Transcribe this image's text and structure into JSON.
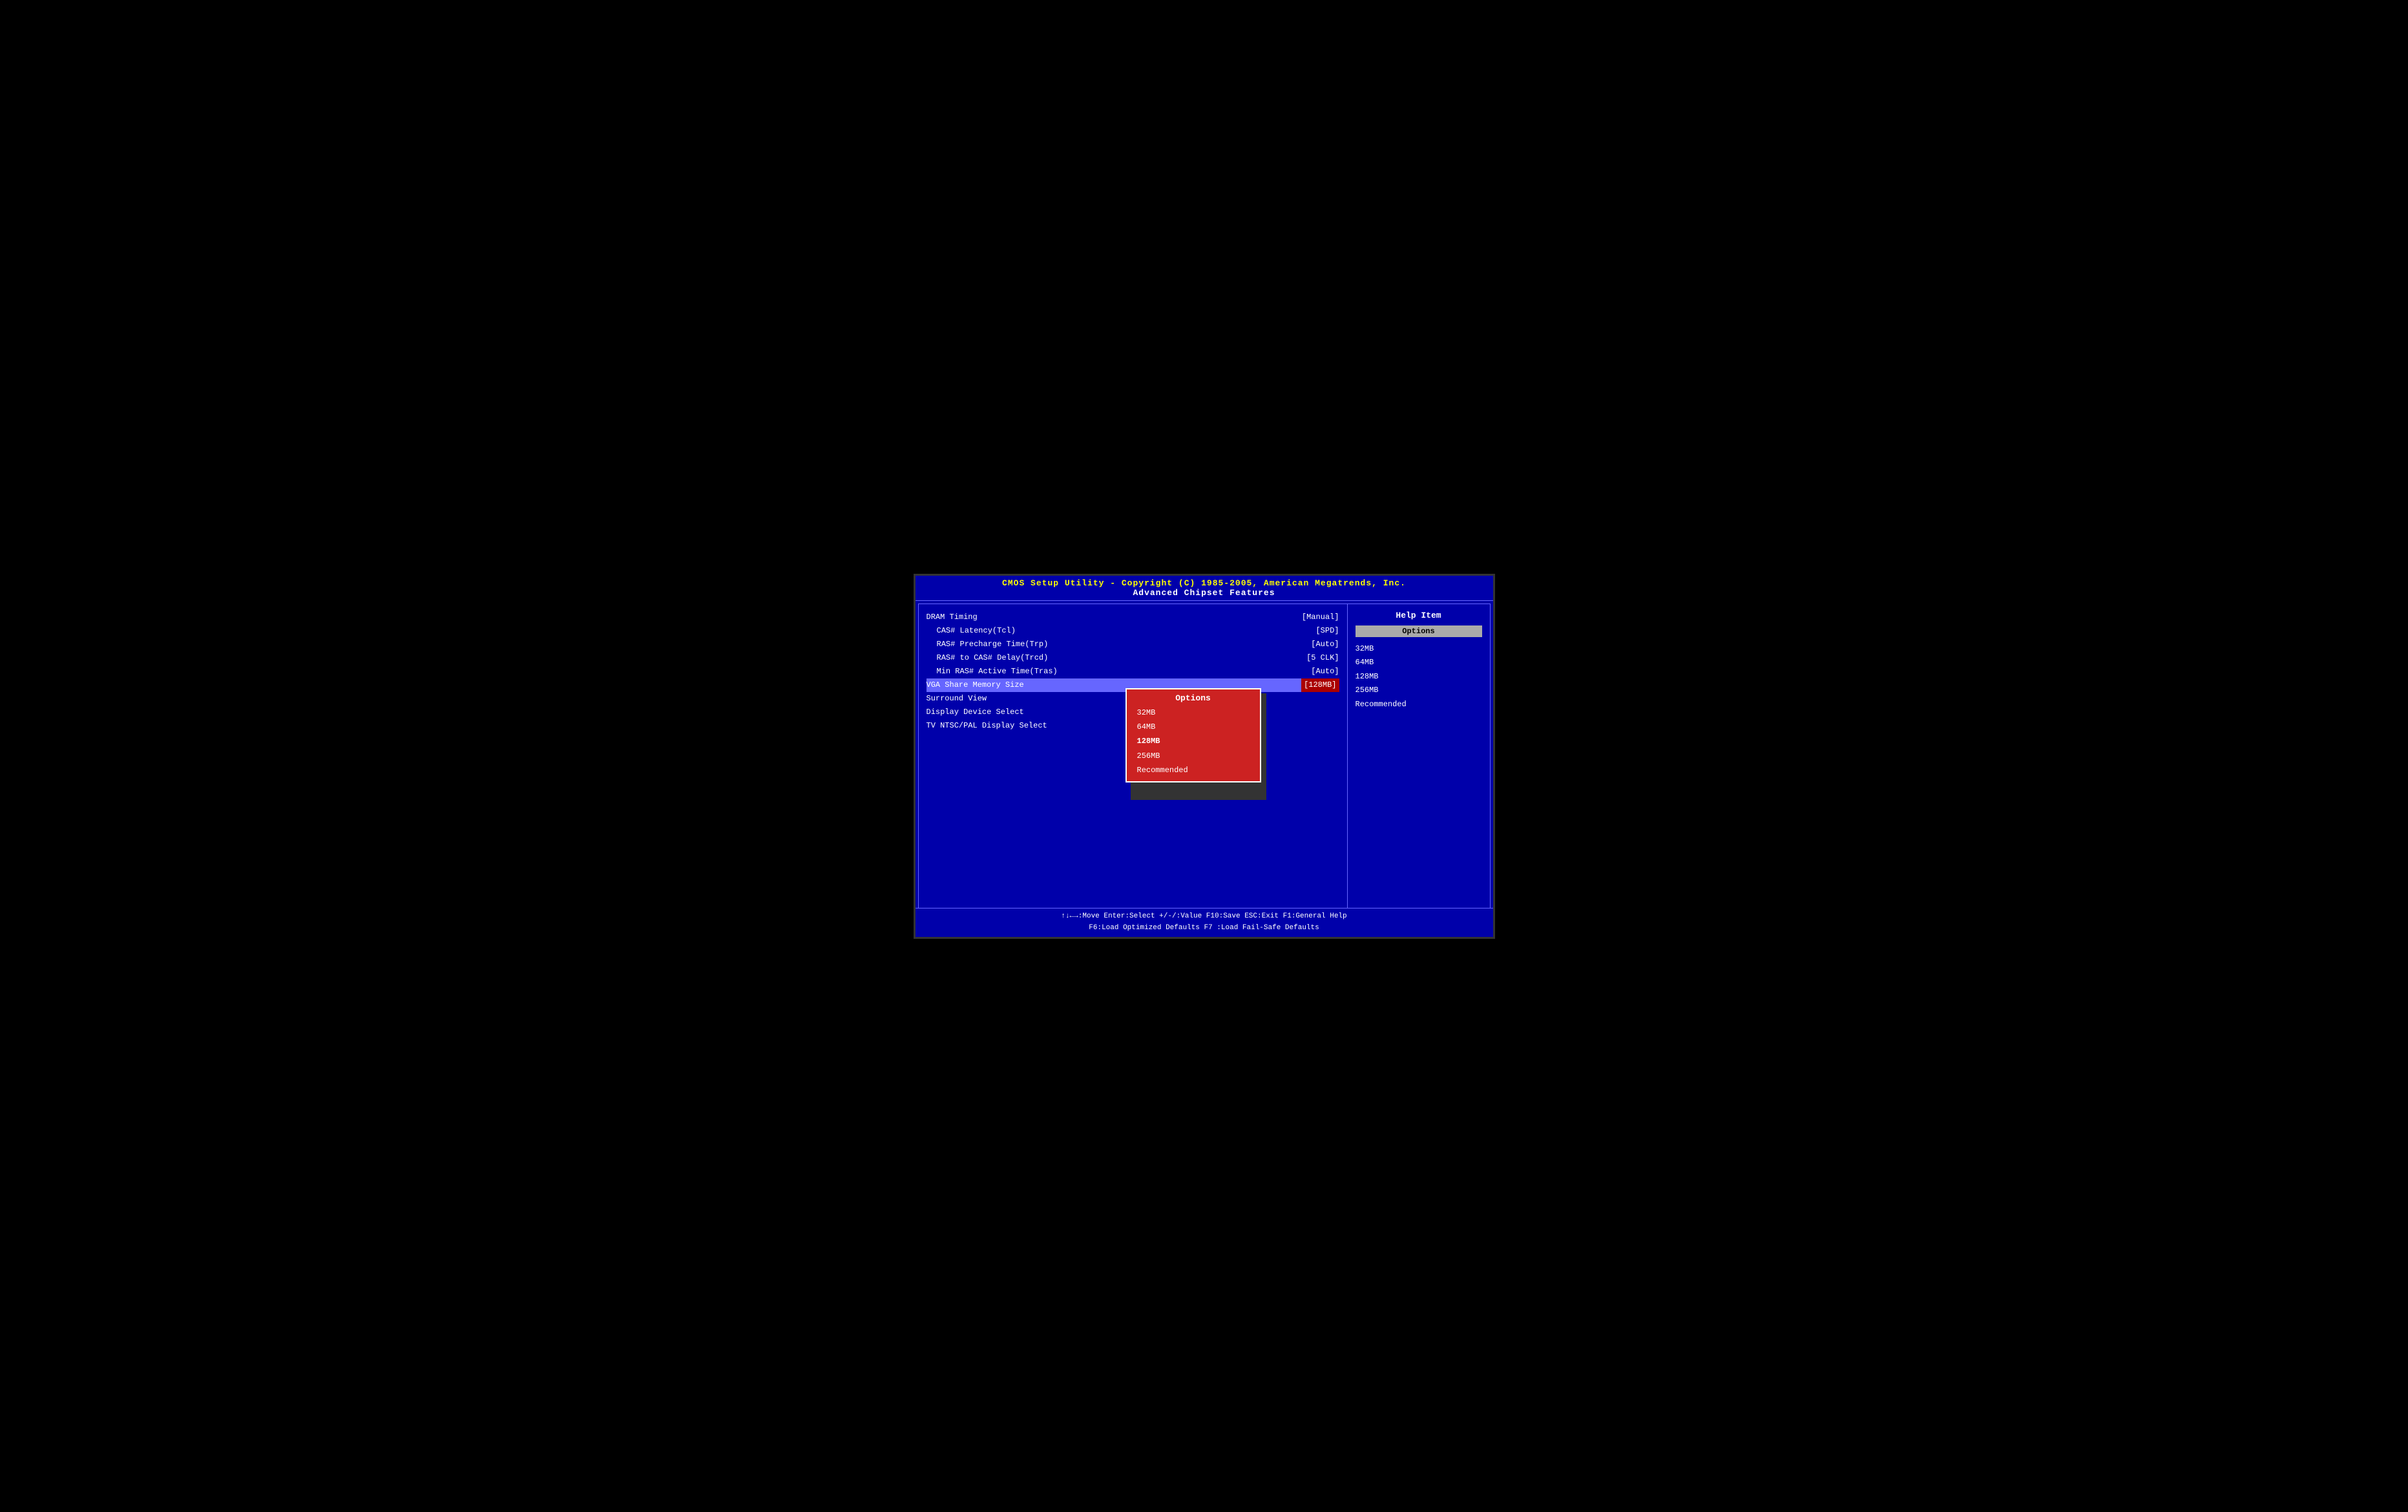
{
  "header": {
    "title": "CMOS Setup Utility - Copyright (C) 1985-2005, American Megatrends, Inc.",
    "subtitle": "Advanced Chipset Features"
  },
  "menu": {
    "items": [
      {
        "label": "DRAM Timing",
        "value": "[Manual]",
        "indent": false
      },
      {
        "label": "CAS# Latency(Tcl)",
        "value": "[SPD]",
        "indent": true
      },
      {
        "label": "RAS# Precharge Time(Trp)",
        "value": "[Auto]",
        "indent": true
      },
      {
        "label": "RAS# to CAS# Delay(Trcd)",
        "value": "[5 CLK]",
        "indent": true
      },
      {
        "label": "Min RAS# Active Time(Tras)",
        "value": "[Auto]",
        "indent": true
      },
      {
        "label": "VGA Share Memory Size",
        "value": "[128MB]",
        "indent": false,
        "selected": true
      },
      {
        "label": "Surround View",
        "value": "",
        "indent": false
      },
      {
        "label": "Display Device Select",
        "value": "",
        "indent": false
      },
      {
        "label": "TV NTSC/PAL Display Select",
        "value": "",
        "indent": false
      }
    ]
  },
  "popup": {
    "title": "Options",
    "items": [
      {
        "label": "32MB",
        "selected": false
      },
      {
        "label": "64MB",
        "selected": false
      },
      {
        "label": "128MB",
        "selected": true
      },
      {
        "label": "256MB",
        "selected": false
      },
      {
        "label": "Recommended",
        "selected": false
      }
    ]
  },
  "help": {
    "title": "Help Item",
    "options_label": "Options",
    "options": [
      "32MB",
      "64MB",
      "128MB",
      "256MB",
      "Recommended"
    ]
  },
  "footer": {
    "row1": "↑↓←→:Move   Enter:Select   +/-/:Value   F10:Save   ESC:Exit   F1:General Help",
    "row2": "F6:Load Optimized Defaults                  F7 :Load Fail-Safe Defaults"
  }
}
